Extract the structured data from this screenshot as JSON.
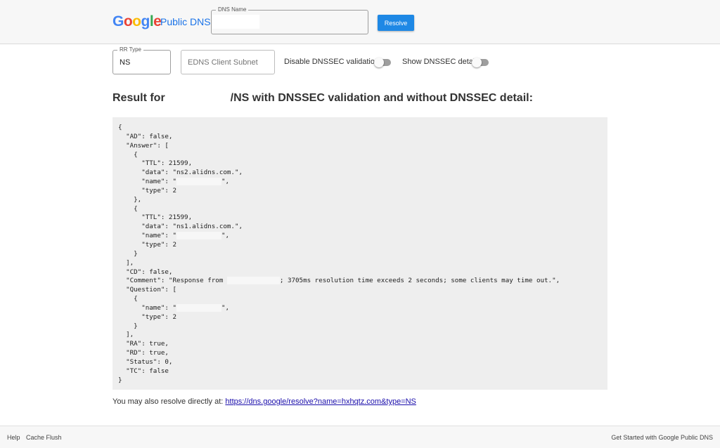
{
  "header": {
    "logo_letters": [
      "G",
      "o",
      "o",
      "g",
      "l",
      "e"
    ],
    "product": "Public DNS",
    "dns_name_label": "DNS Name",
    "dns_name_value": "",
    "resolve_label": "Resolve"
  },
  "options": {
    "rr_type_label": "RR Type",
    "rr_type_value": "NS",
    "edns_placeholder": "EDNS Client Subnet",
    "disable_dnssec_label": "Disable DNSSEC validation",
    "disable_dnssec_on": false,
    "show_dnssec_label": "Show DNSSEC detail",
    "show_dnssec_on": false
  },
  "result": {
    "title_prefix": "Result for",
    "title_suffix": "/NS with DNSSEC validation and without DNSSEC detail:",
    "json_lines": [
      "{",
      "  \"AD\": false,",
      "  \"Answer\": [",
      "    {",
      "      \"TTL\": 21599,",
      "      \"data\": \"ns2.alidns.com.\",",
      "      \"name\": \"",
      "      \"type\": 2",
      "    },",
      "    {",
      "      \"TTL\": 21599,",
      "      \"data\": \"ns1.alidns.com.\",",
      "      \"name\": \"",
      "      \"type\": 2",
      "    }",
      "  ],",
      "  \"CD\": false,",
      "  \"Comment\": \"Response from ",
      "  \"Question\": [",
      "    {",
      "      \"name\": \"",
      "      \"type\": 2",
      "    }",
      "  ],",
      "  \"RA\": true,",
      "  \"RD\": true,",
      "  \"Status\": 0,",
      "  \"TC\": false",
      "}"
    ],
    "name_tail": "\",",
    "comment_tail": "; 3705ms resolution time exceeds 2 seconds; some clients may time out.\",",
    "direct_text": "You may also resolve directly at: ",
    "direct_link": "https://dns.google/resolve?name=hxhqtz.com&type=NS"
  },
  "footer": {
    "help": "Help",
    "cache_flush": "Cache Flush",
    "get_started": "Get Started with Google Public DNS"
  },
  "colors": {
    "accent": "#1e88e5",
    "link": "#1a0dab"
  }
}
